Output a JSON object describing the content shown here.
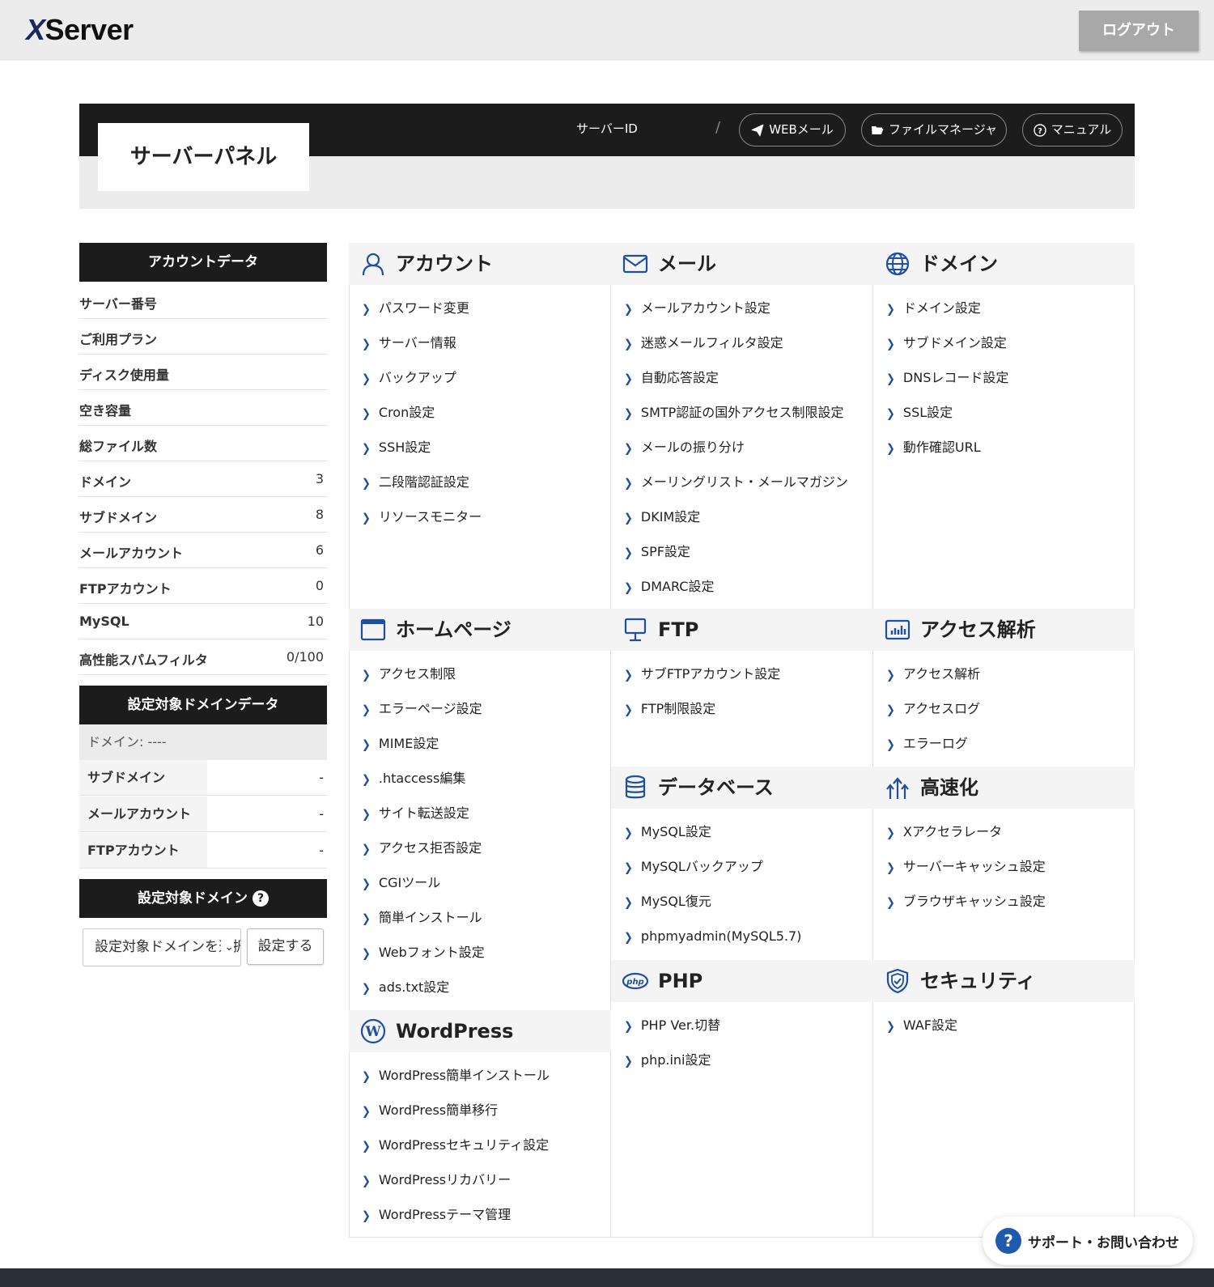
{
  "header": {
    "logo_x": "X",
    "logo_rest": "Server",
    "logout": "ログアウト",
    "panel_title": "サーバーパネル",
    "server_id_label": "サーバーID",
    "separator": "/",
    "webmail": "WEBメール",
    "file_manager": "ファイルマネージャ",
    "manual": "マニュアル"
  },
  "account_data": {
    "title": "アカウントデータ",
    "rows": [
      {
        "label": "サーバー番号",
        "value": ""
      },
      {
        "label": "ご利用プラン",
        "value": ""
      },
      {
        "label": "ディスク使用量",
        "value": ""
      },
      {
        "label": "空き容量",
        "value": ""
      },
      {
        "label": "総ファイル数",
        "value": ""
      },
      {
        "label": "ドメイン",
        "value": "3"
      },
      {
        "label": "サブドメイン",
        "value": "8"
      },
      {
        "label": "メールアカウント",
        "value": "6"
      },
      {
        "label": "FTPアカウント",
        "value": "0"
      },
      {
        "label": "MySQL",
        "value": "10"
      },
      {
        "label": "高性能スパムフィルタ",
        "value": "0/100"
      }
    ]
  },
  "domain_data": {
    "title": "設定対象ドメインデータ",
    "domain_line": "ドメイン: ----",
    "rows": [
      {
        "label": "サブドメイン",
        "value": "-"
      },
      {
        "label": "メールアカウント",
        "value": "-"
      },
      {
        "label": "FTPアカウント",
        "value": "-"
      }
    ]
  },
  "target_domain": {
    "title": "設定対象ドメイン",
    "help": "?",
    "select_value": "設定対象ドメインを選択",
    "select_chevron": "⌄",
    "set_button": "設定する"
  },
  "sections": {
    "account": {
      "title": "アカウント",
      "icon": "user-icon",
      "items": [
        "パスワード変更",
        "サーバー情報",
        "バックアップ",
        "Cron設定",
        "SSH設定",
        "二段階認証設定",
        "リソースモニター"
      ]
    },
    "mail": {
      "title": "メール",
      "icon": "mail-icon",
      "items": [
        "メールアカウント設定",
        "迷惑メールフィルタ設定",
        "自動応答設定",
        "SMTP認証の国外アクセス制限設定",
        "メールの振り分け",
        "メーリングリスト・メールマガジン",
        "DKIM設定",
        "SPF設定",
        "DMARC設定"
      ]
    },
    "domain": {
      "title": "ドメイン",
      "icon": "globe-icon",
      "items": [
        "ドメイン設定",
        "サブドメイン設定",
        "DNSレコード設定",
        "SSL設定",
        "動作確認URL"
      ]
    },
    "homepage": {
      "title": "ホームページ",
      "icon": "browser-window-icon",
      "items": [
        "アクセス制限",
        "エラーページ設定",
        "MIME設定",
        ".htaccess編集",
        "サイト転送設定",
        "アクセス拒否設定",
        "CGIツール",
        "簡単インストール",
        "Webフォント設定",
        "ads.txt設定"
      ]
    },
    "ftp": {
      "title": "FTP",
      "icon": "monitor-icon",
      "items": [
        "サブFTPアカウント設定",
        "FTP制限設定"
      ]
    },
    "analytics": {
      "title": "アクセス解析",
      "icon": "bar-chart-icon",
      "items": [
        "アクセス解析",
        "アクセスログ",
        "エラーログ"
      ]
    },
    "database": {
      "title": "データベース",
      "icon": "database-icon",
      "items": [
        "MySQL設定",
        "MySQLバックアップ",
        "MySQL復元",
        "phpmyadmin(MySQL5.7)"
      ]
    },
    "speed": {
      "title": "高速化",
      "icon": "speed-arrows-icon",
      "items": [
        "Xアクセラレータ",
        "サーバーキャッシュ設定",
        "ブラウザキャッシュ設定"
      ]
    },
    "wordpress": {
      "title": "WordPress",
      "icon": "wordpress-icon",
      "items": [
        "WordPress簡単インストール",
        "WordPress簡単移行",
        "WordPressセキュリティ設定",
        "WordPressリカバリー",
        "WordPressテーマ管理"
      ]
    },
    "php": {
      "title": "PHP",
      "icon": "php-icon",
      "badge": "php",
      "items": [
        "PHP Ver.切替",
        "php.ini設定"
      ]
    },
    "security": {
      "title": "セキュリティ",
      "icon": "shield-icon",
      "items": [
        "WAF設定"
      ]
    }
  },
  "support": {
    "label": "サポート・お問い合わせ",
    "icon": "?"
  },
  "colors": {
    "accent": "#1e4fa0",
    "dark": "#1c1c1c",
    "light_bg": "#ececec"
  }
}
